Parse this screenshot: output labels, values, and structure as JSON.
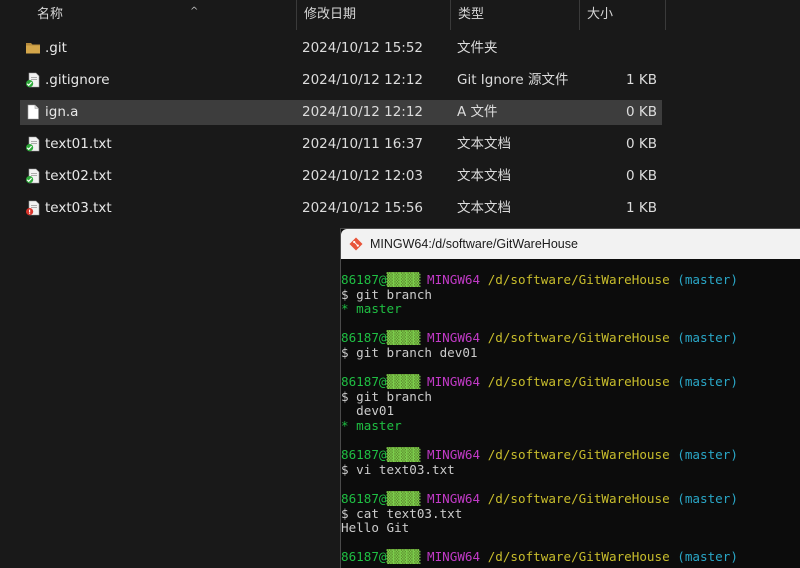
{
  "columns": {
    "name": "名称",
    "date": "修改日期",
    "type": "类型",
    "size": "大小"
  },
  "files": [
    {
      "name": ".git",
      "date": "2024/10/12 15:52",
      "type": "文件夹",
      "size": "",
      "icon": "folder-icon"
    },
    {
      "name": ".gitignore",
      "date": "2024/10/12 12:12",
      "type": "Git Ignore 源文件",
      "size": "1 KB",
      "icon": "git-file-icon"
    },
    {
      "name": "ign.a",
      "date": "2024/10/12 12:12",
      "type": "A 文件",
      "size": "0 KB",
      "icon": "blank-file-icon"
    },
    {
      "name": "text01.txt",
      "date": "2024/10/11 16:37",
      "type": "文本文档",
      "size": "0 KB",
      "icon": "git-tracked-file-icon"
    },
    {
      "name": "text02.txt",
      "date": "2024/10/12 12:03",
      "type": "文本文档",
      "size": "0 KB",
      "icon": "git-tracked-file-icon"
    },
    {
      "name": "text03.txt",
      "date": "2024/10/12 15:56",
      "type": "文本文档",
      "size": "1 KB",
      "icon": "git-modified-file-icon"
    }
  ],
  "selected_file": "ign.a",
  "terminal": {
    "title": "MINGW64:/d/software/GitWareHouse",
    "prompt": {
      "user": "86187@",
      "host": "▒▒▒▒▒",
      "system": "MINGW64",
      "path": "/d/software/GitWareHouse",
      "branch": "(master)"
    },
    "blocks": [
      {
        "command": "$ git branch",
        "output": [
          {
            "text": "* master",
            "green": true
          }
        ]
      },
      {
        "command": "$ git branch dev01",
        "output": []
      },
      {
        "command": "$ git branch",
        "output": [
          {
            "text": "  dev01",
            "green": false
          },
          {
            "text": "* master",
            "green": true
          }
        ]
      },
      {
        "command": "$ vi text03.txt",
        "output": []
      },
      {
        "command": "$ cat text03.txt",
        "output": [
          {
            "text": "Hello Git",
            "green": false
          }
        ]
      }
    ]
  },
  "colors": {
    "background": "#191919",
    "selection": "#3d3d3d",
    "terminal_bg": "#0c0c0c",
    "prompt_user": "#1fbf43",
    "prompt_system": "#c13ac6",
    "prompt_path": "#c8bd2c",
    "prompt_branch": "#2aa7c7"
  }
}
